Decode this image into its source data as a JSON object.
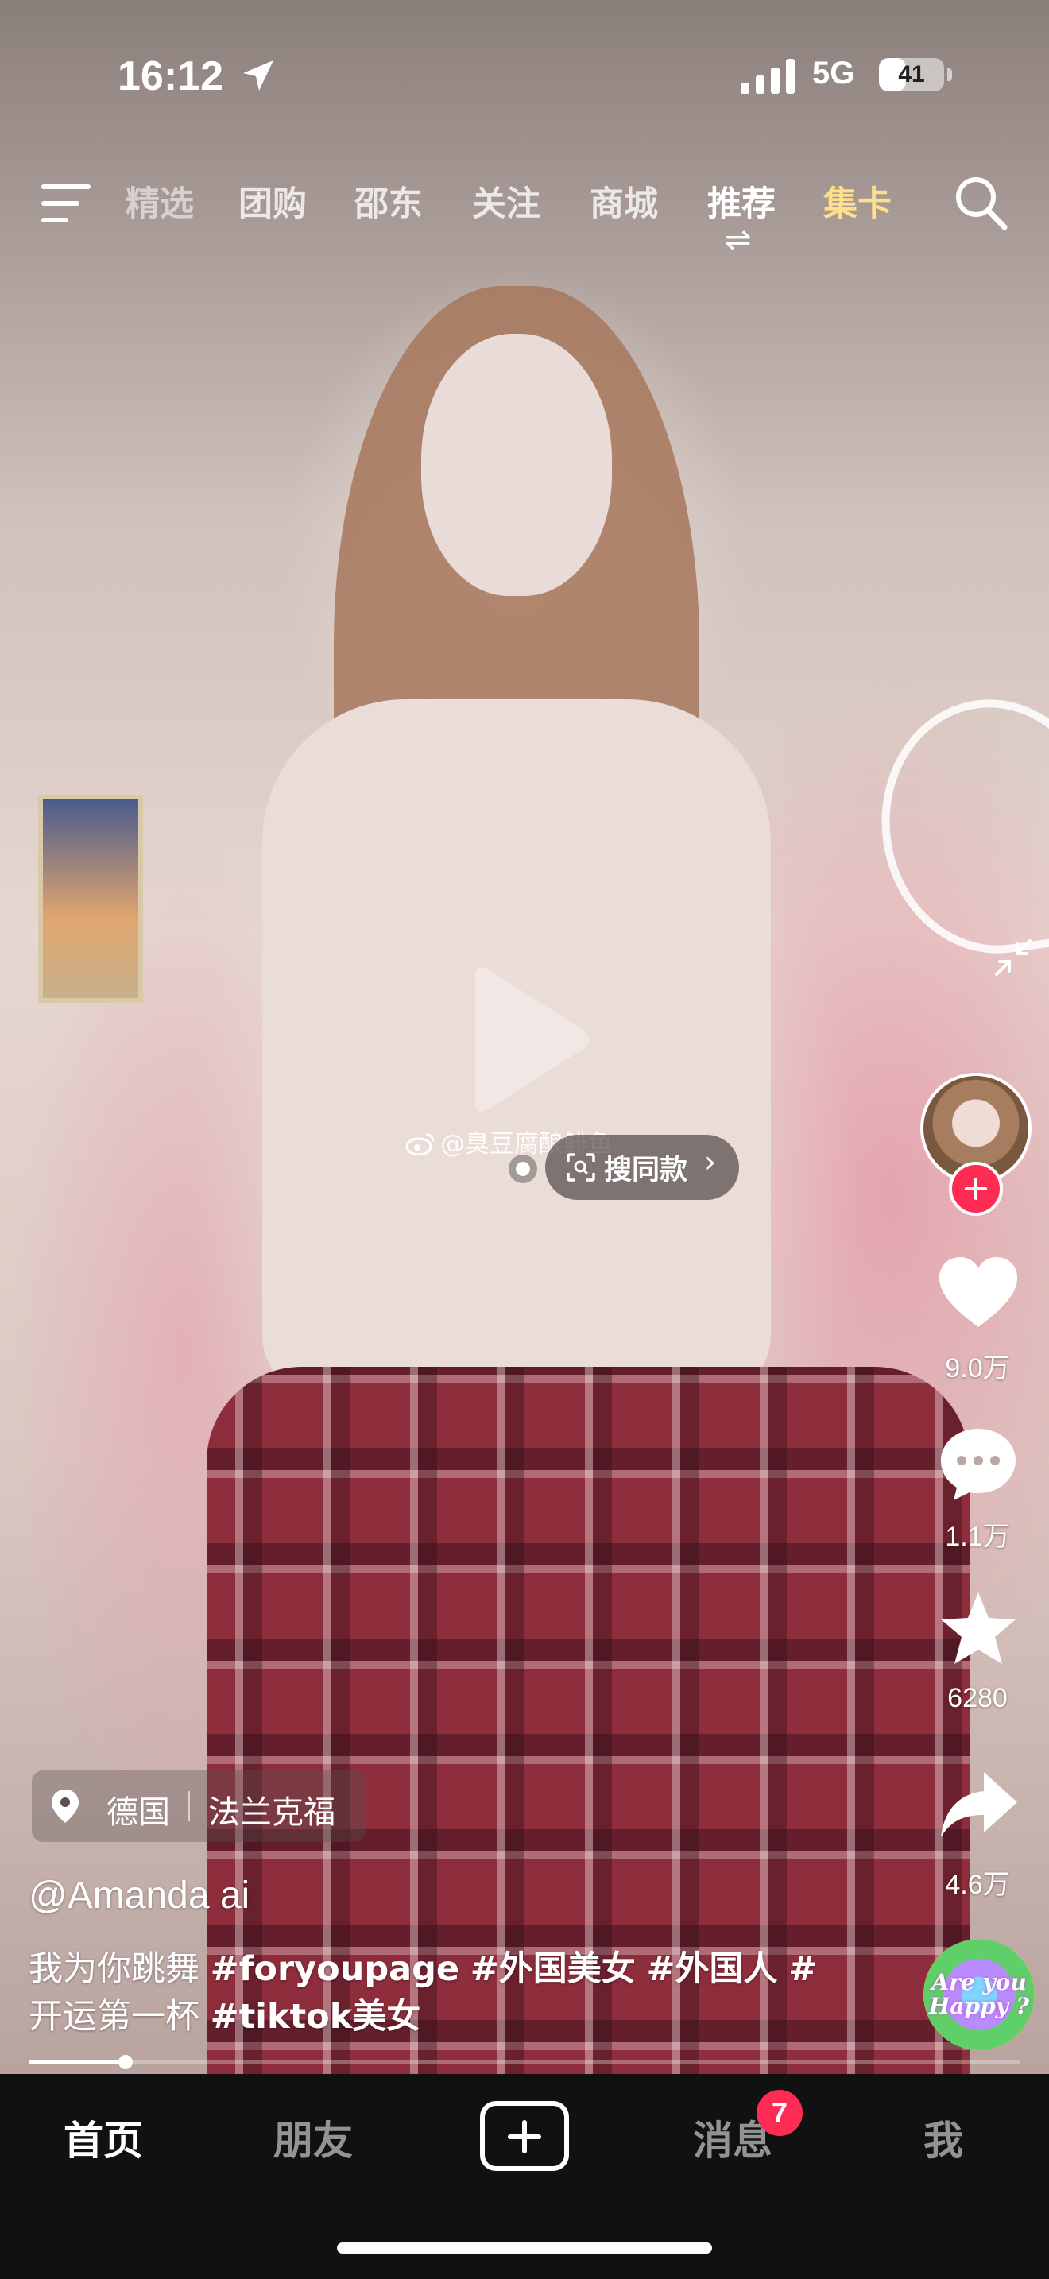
{
  "status_bar": {
    "time": "16:12",
    "network": "5G",
    "battery_level": "41",
    "battery_fraction": 0.41
  },
  "top_nav": {
    "tabs": [
      {
        "label": "精选",
        "state": "partially-scrolled"
      },
      {
        "label": "团购",
        "state": "normal"
      },
      {
        "label": "邵东",
        "state": "normal"
      },
      {
        "label": "关注",
        "state": "normal"
      },
      {
        "label": "商城",
        "state": "normal"
      },
      {
        "label": "推荐",
        "state": "active"
      },
      {
        "label": "集卡",
        "state": "highlight"
      }
    ],
    "switch_glyph": "⇌",
    "highlight_color": "#ffe08a"
  },
  "video": {
    "watermark": "@臭豆腐酿鲱鱼",
    "search_same_label": "搜同款",
    "search_same_chevron": "›",
    "progress_fraction": 0.098
  },
  "right_rail": {
    "likes": "9.0万",
    "comments": "1.1万",
    "favorites": "6280",
    "shares": "4.6万",
    "music_disc_text": "Are you Happy ?"
  },
  "info": {
    "location_country": "德国",
    "location_city": "法兰克福",
    "author": "@Amanda ai",
    "caption_text": "我为你跳舞",
    "caption_tags": [
      "#foryoupage",
      "#外国美女",
      "#外国人",
      "#",
      "开运第一杯",
      "#tiktok美女"
    ]
  },
  "bottom_nav": {
    "tabs": [
      {
        "label": "首页",
        "active": true
      },
      {
        "label": "朋友",
        "active": false
      },
      {
        "label": "消息",
        "active": false
      },
      {
        "label": "我",
        "active": false
      }
    ],
    "messages_badge": "7",
    "badge_color": "#fe2c55"
  }
}
